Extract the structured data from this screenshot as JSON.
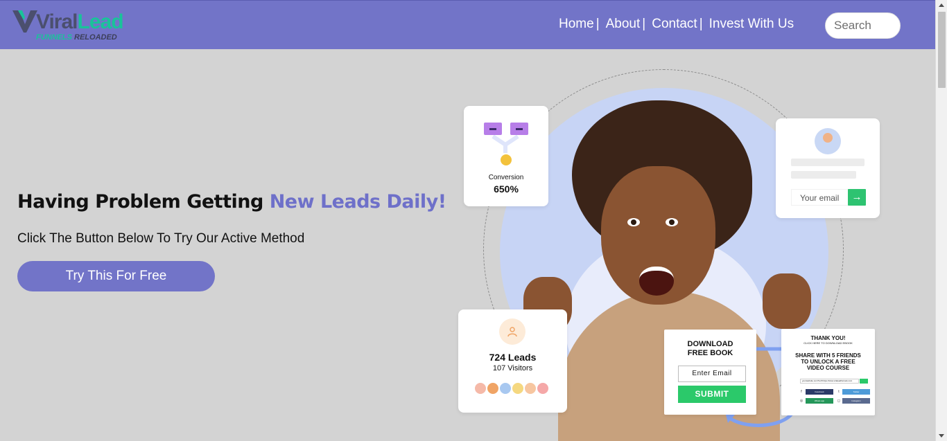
{
  "header": {
    "logo": {
      "viral": "Viral",
      "lead": "Lead",
      "sub_funnels": "FUNNELS",
      "sub_reloaded": "RELOADED"
    },
    "nav": [
      {
        "label": "Home"
      },
      {
        "label": "About"
      },
      {
        "label": "Contact"
      },
      {
        "label": "Invest With Us"
      }
    ],
    "separator": "|",
    "search": {
      "placeholder": "Search",
      "value": ""
    }
  },
  "hero": {
    "headline_main": "Having Problem Getting ",
    "headline_accent": "New Leads Daily!",
    "subline": "Click The Button Below To Try Our Active Method",
    "cta_label": "Try This For Free"
  },
  "illustration": {
    "conversion": {
      "label": "Conversion",
      "value": "650%"
    },
    "email_card": {
      "placeholder": "Your email",
      "button_icon": "→"
    },
    "leads": {
      "count": "724 Leads",
      "visitors": "107 Visitors",
      "icon": "person-icon"
    },
    "book": {
      "title_line1": "DOWNLOAD",
      "title_line2": "FREE BOOK",
      "input": "Enter Email",
      "submit": "SUBMIT"
    },
    "thanks": {
      "title": "THANK YOU!",
      "small": "CLICK HERE TO DOWNLOAD EBOOK",
      "share_line1": "SHARE WITH 5 FRIENDS",
      "share_line2": "TO UNLOCK A FREE",
      "share_line3": "VIDEO COURSE",
      "link": "yourwebsite.com?ref=https://www.viraleadfunnels.com",
      "socials": [
        "Facebook",
        "Twitter",
        "Whats app",
        "Instagram"
      ]
    }
  },
  "colors": {
    "header_bg": "#7274c8",
    "page_bg": "#d3d3d3",
    "accent": "#6e70c9",
    "logo_green": "#19c39a",
    "submit_green": "#2bc96a"
  }
}
